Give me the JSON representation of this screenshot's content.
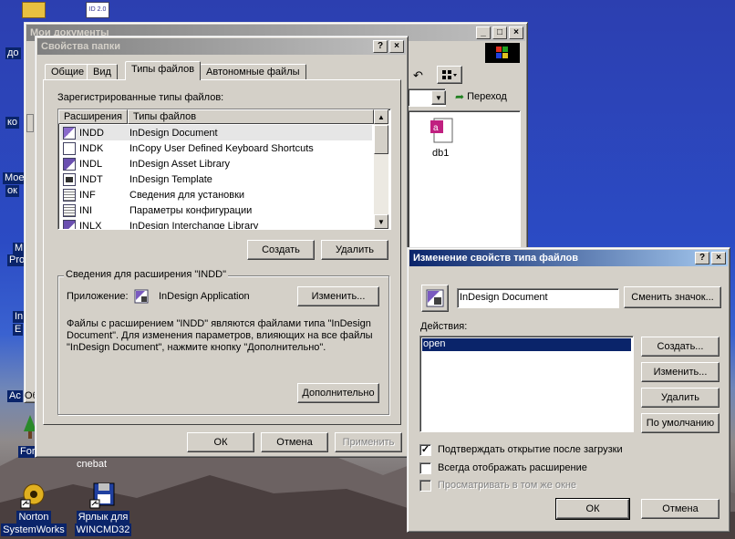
{
  "desktop": {
    "icons": [
      {
        "name": "Norton SystemWorks",
        "line1": "Norton",
        "line2": "SystemWorks"
      },
      {
        "name": "wincmd-shortcut",
        "line1": "Ярлык для",
        "line2": "WINCMD32"
      }
    ],
    "stubs": [
      "до",
      "ко",
      "Мое",
      "ок",
      "М",
      "Pro",
      "In",
      "E",
      "Ac",
      "For"
    ],
    "id_badge": "ID 2.0",
    "under_window_label": "cnebat"
  },
  "explorer": {
    "title": "Мои документы",
    "go_label": "Переход",
    "file_name": "db1",
    "status_fragment": "Об"
  },
  "folder_options": {
    "title": "Свойства папки",
    "help_btn": "?",
    "close_btn": "×",
    "tabs": [
      "Общие",
      "Вид",
      "Типы файлов",
      "Автономные файлы"
    ],
    "selected_tab": 2,
    "registered_label": "Зарегистрированные типы файлов:",
    "columns": {
      "ext": "Расширения",
      "type": "Типы файлов"
    },
    "rows": [
      {
        "ext": "INDD",
        "type": "InDesign Document",
        "icon": "id"
      },
      {
        "ext": "INDK",
        "type": "InCopy User Defined Keyboard Shortcuts",
        "icon": "blank"
      },
      {
        "ext": "INDL",
        "type": "InDesign Asset Library",
        "icon": "lib"
      },
      {
        "ext": "INDT",
        "type": "InDesign Template",
        "icon": "idt"
      },
      {
        "ext": "INF",
        "type": "Сведения для установки",
        "icon": "txt"
      },
      {
        "ext": "INI",
        "type": "Параметры конфигурации",
        "icon": "txt"
      },
      {
        "ext": "INLX",
        "type": "InDesign Interchange Library",
        "icon": "lib"
      }
    ],
    "create_btn": "Создать",
    "delete_btn": "Удалить",
    "details_title": "Сведения для расширения \"INDD\"",
    "app_label": "Приложение:",
    "app_name": "InDesign Application",
    "change_btn": "Изменить...",
    "description": "Файлы с расширением \"INDD\" являются файлами типа \"InDesign Document\". Для изменения параметров, влияющих на все файлы \"InDesign Document\", нажмите кнопку \"Дополнительно\".",
    "advanced_btn": "Дополнительно",
    "ok_btn": "ОК",
    "cancel_btn": "Отмена",
    "apply_btn": "Применить"
  },
  "edit_type": {
    "title": "Изменение свойств типа файлов",
    "help_btn": "?",
    "close_btn": "×",
    "type_name": "InDesign Document",
    "change_icon_btn": "Сменить значок...",
    "actions_label": "Действия:",
    "actions": [
      "open"
    ],
    "create_btn": "Создать...",
    "edit_btn": "Изменить...",
    "delete_btn": "Удалить",
    "default_btn": "По умолчанию",
    "cb_confirm": {
      "label": "Подтверждать открытие после загрузки",
      "checked": true
    },
    "cb_show_ext": {
      "label": "Всегда отображать расширение",
      "checked": false
    },
    "cb_browse_same": {
      "label": "Просматривать в том же окне",
      "checked": false,
      "disabled": true
    },
    "ok_btn": "ОК",
    "cancel_btn": "Отмена"
  },
  "colors": {
    "titlebar_active": "#0a246a",
    "titlebar_inactive": "#808080",
    "face": "#d4d0c8",
    "selection": "#0a246a"
  }
}
